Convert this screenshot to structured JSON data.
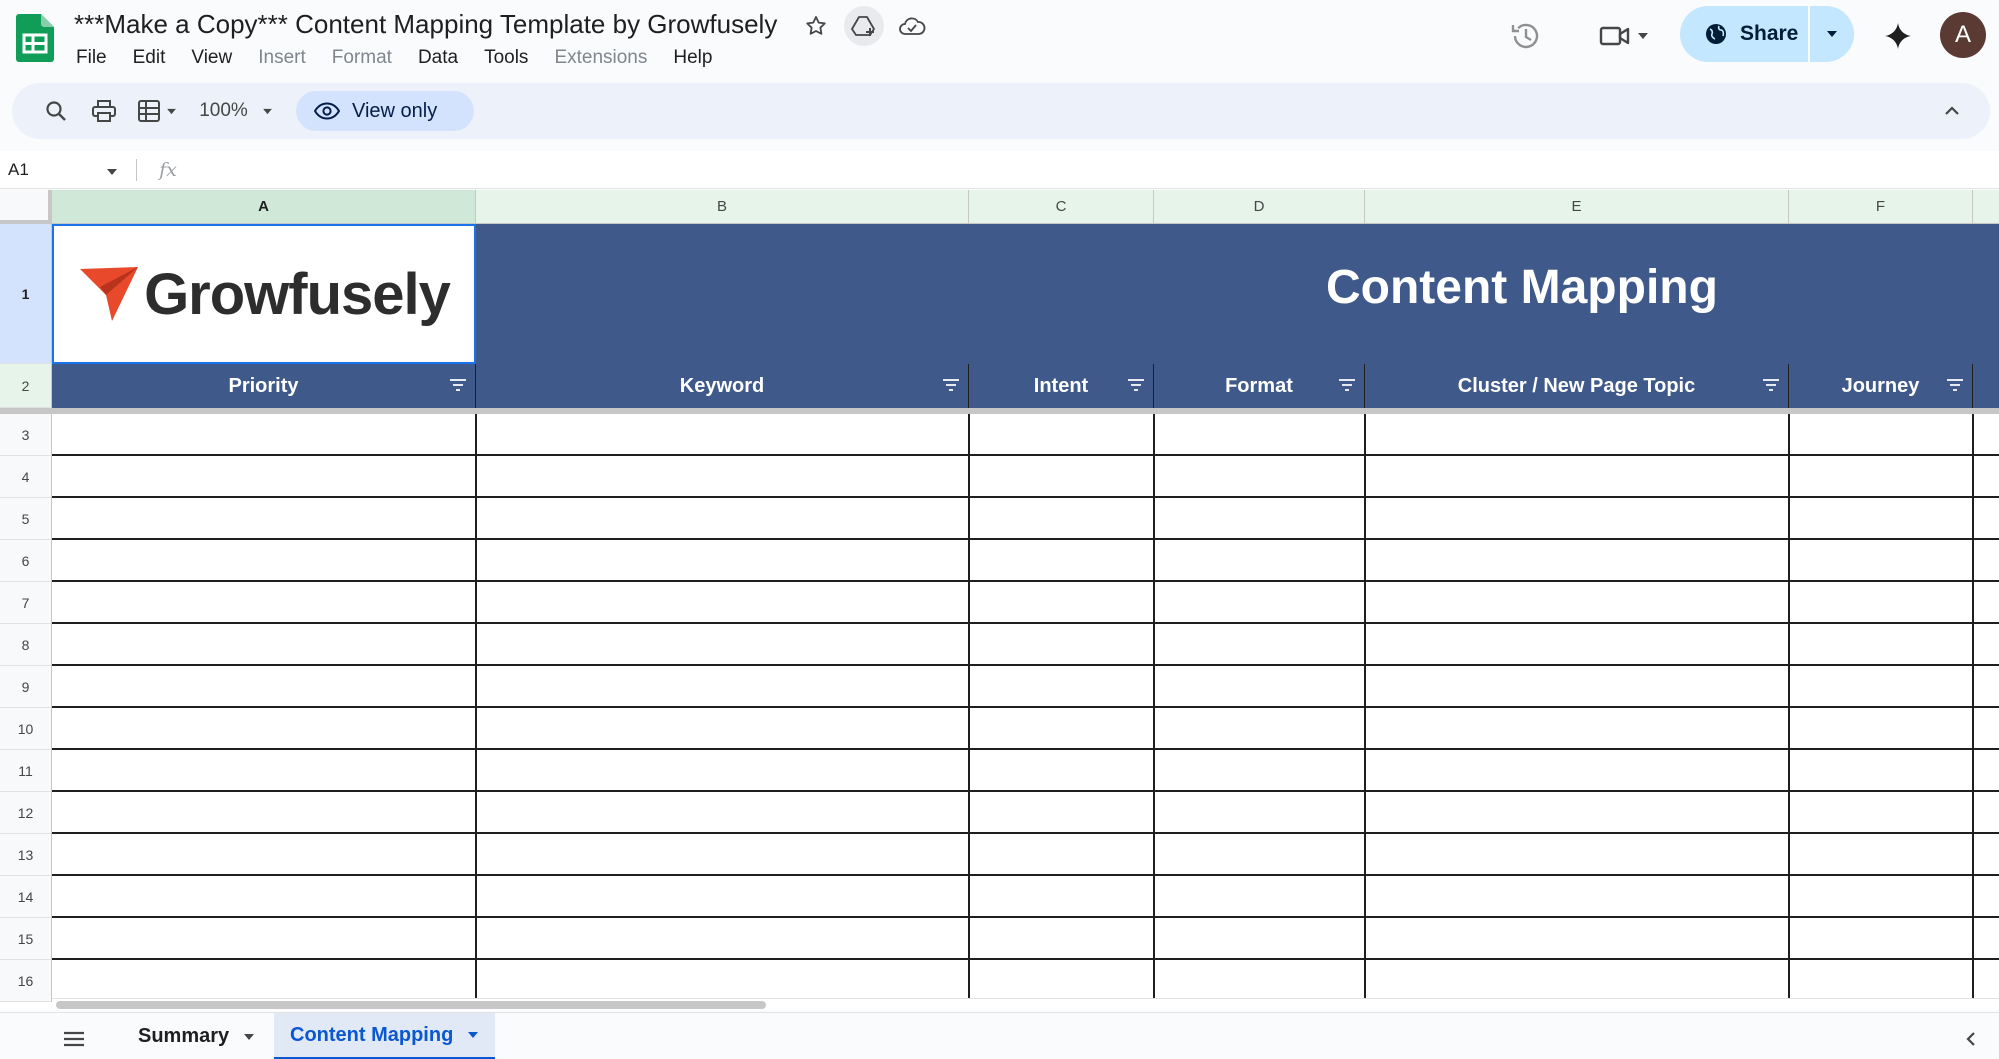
{
  "app": {
    "doc_title": "***Make a Copy*** Content Mapping Template by Growfusely",
    "menu": [
      "File",
      "Edit",
      "View",
      "Insert",
      "Format",
      "Data",
      "Tools",
      "Extensions",
      "Help"
    ],
    "menu_disabled": [
      "Insert",
      "Format",
      "Extensions"
    ],
    "share_label": "Share",
    "avatar_letter": "A"
  },
  "toolbar": {
    "zoom": "100%",
    "view_only_label": "View only"
  },
  "formula_bar": {
    "name_box": "A1",
    "fx_label": "fx",
    "formula": ""
  },
  "grid": {
    "columns": [
      "A",
      "B",
      "C",
      "D",
      "E",
      "F"
    ],
    "rows": [
      "1",
      "2",
      "3",
      "4",
      "5",
      "6",
      "7",
      "8",
      "9",
      "10",
      "11",
      "12",
      "13",
      "14",
      "15",
      "16"
    ],
    "logo_text": "Growfusely",
    "banner_title": "Content Mapping",
    "headers": [
      "Priority",
      "Keyword",
      "Intent",
      "Format",
      "Cluster / New Page Topic",
      "Journey"
    ]
  },
  "sheets": {
    "tabs": [
      "Summary",
      "Content Mapping"
    ],
    "active": "Content Mapping"
  },
  "colors": {
    "banner": "#3f5a8a",
    "logo_accent": "#e8492a",
    "share_bg": "#c2e7ff",
    "active_tab": "#0b57d0"
  }
}
